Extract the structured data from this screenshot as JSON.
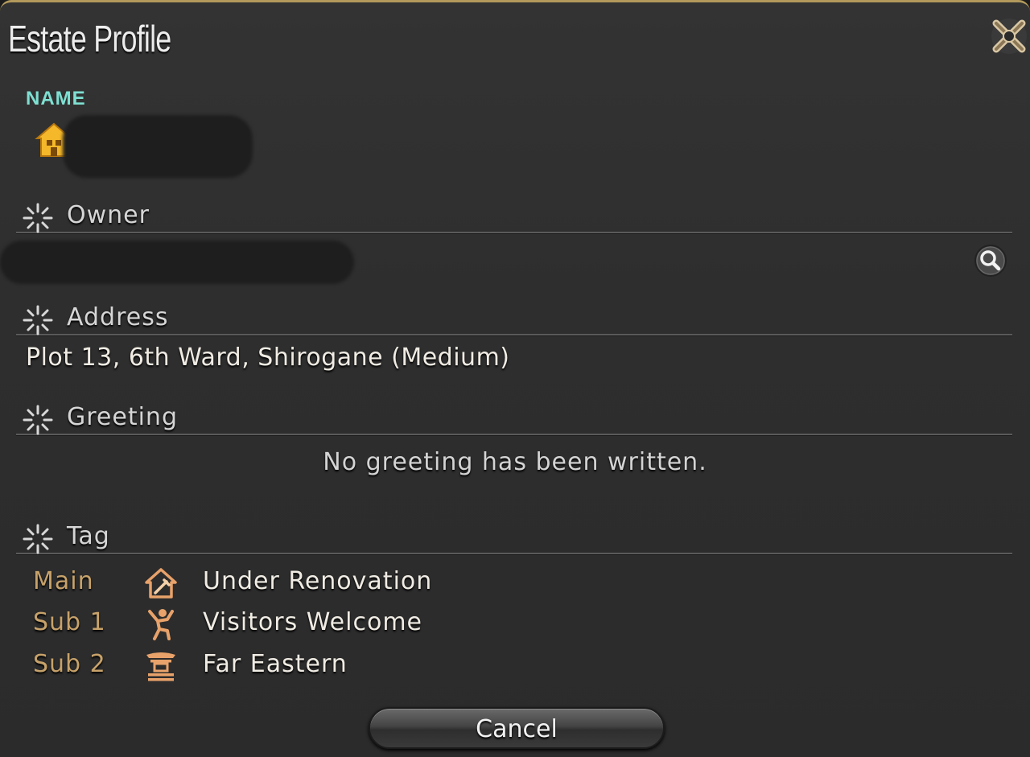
{
  "window": {
    "title": "Estate Profile"
  },
  "name": {
    "label": "NAME"
  },
  "owner": {
    "label": "Owner"
  },
  "address": {
    "label": "Address",
    "value": "Plot 13, 6th Ward, Shirogane (Medium)"
  },
  "greeting": {
    "label": "Greeting",
    "value": "No greeting has been written."
  },
  "tag": {
    "label": "Tag",
    "rows": [
      {
        "slot": "Main",
        "icon": "renovation-icon",
        "value": "Under Renovation"
      },
      {
        "slot": "Sub 1",
        "icon": "visitors-icon",
        "value": "Visitors Welcome"
      },
      {
        "slot": "Sub 2",
        "icon": "far-eastern-icon",
        "value": "Far Eastern"
      }
    ]
  },
  "buttons": {
    "cancel": "Cancel"
  },
  "colors": {
    "accent": "#7ee0d2",
    "slot_label": "#c7a26a",
    "house": "#f4b82a",
    "tag_icon": "#e8a26a"
  }
}
